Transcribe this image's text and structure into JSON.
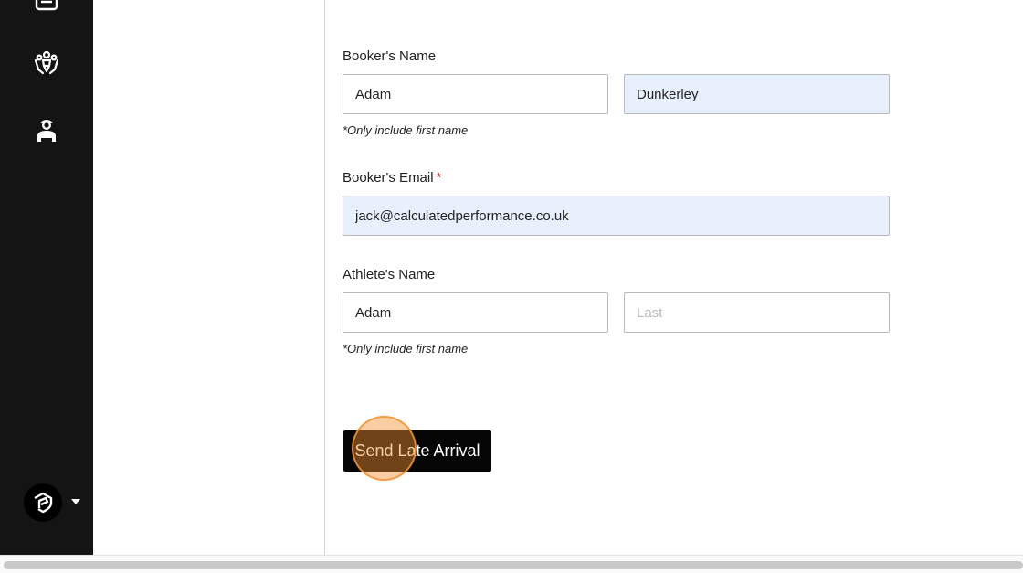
{
  "sidebar": {
    "icons": [
      "list-icon",
      "team-icon",
      "coach-icon"
    ],
    "brand_icon": "brand-logo-icon",
    "caret_icon": "caret-down-icon"
  },
  "form": {
    "booker_name": {
      "label": "Booker's Name",
      "first_value": "Adam",
      "last_value": "Dunkerley",
      "hint": "*Only include first name"
    },
    "booker_email": {
      "label": "Booker's Email",
      "required_mark": "*",
      "value": "jack@calculatedperformance.co.uk"
    },
    "athlete_name": {
      "label": "Athlete's Name",
      "first_value": "Adam",
      "last_placeholder": "Last",
      "hint": "*Only include first name"
    },
    "submit_label": "Send Late Arrival"
  },
  "colors": {
    "sidebar_bg": "#141414",
    "autofill_bg": "#e8f0fe",
    "button_bg": "#050505",
    "click_highlight": "#f39232",
    "required": "#c0392b"
  }
}
